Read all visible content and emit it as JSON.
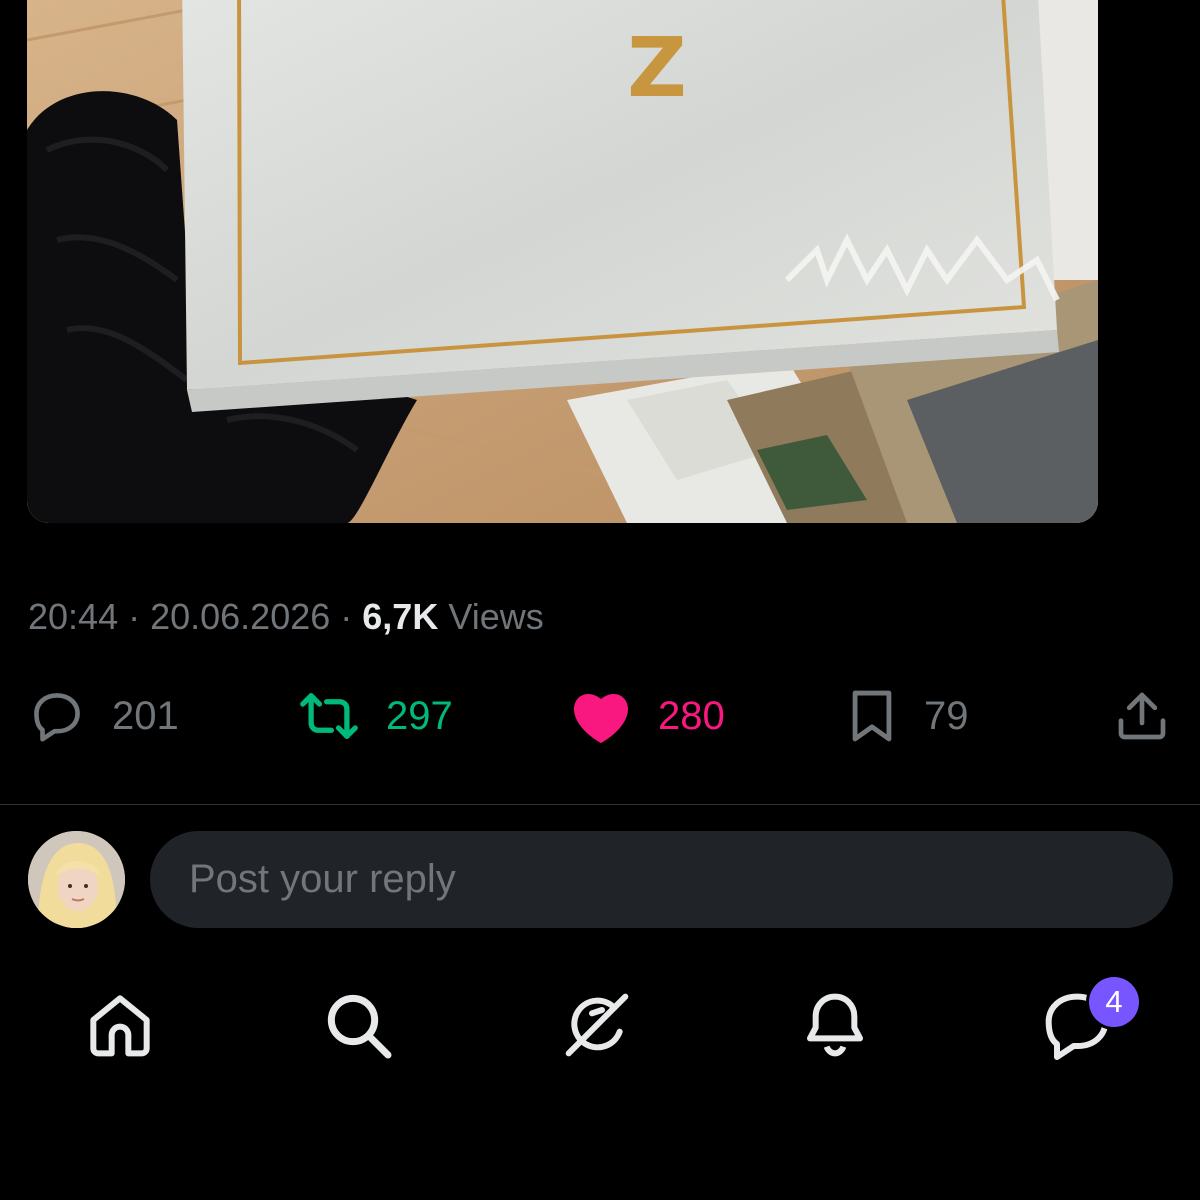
{
  "post": {
    "time": "20:44",
    "sep1": " · ",
    "date": "20.06.2026",
    "sep2": " · ",
    "views_count": "6,7K",
    "views_label": " Views",
    "box_letter": "Z"
  },
  "actions": {
    "replies": "201",
    "reposts": "297",
    "likes": "280",
    "bookmarks": "79"
  },
  "reply": {
    "placeholder": "Post your reply"
  },
  "nav": {
    "items": [
      "home-icon",
      "search-icon",
      "grok-icon",
      "notifications-icon",
      "messages-icon"
    ],
    "messages_badge": "4"
  },
  "colors": {
    "background": "#000000",
    "muted": "#71767b",
    "repost_active": "#00ba7c",
    "like_active": "#f91880",
    "badge": "#7856ff"
  }
}
